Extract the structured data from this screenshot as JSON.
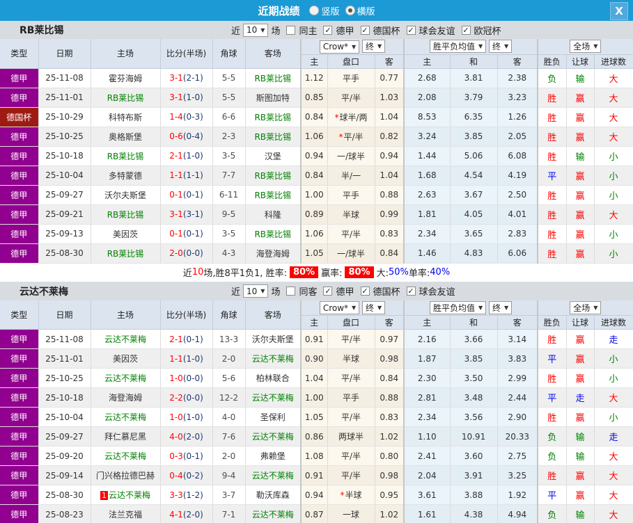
{
  "topbar": {
    "title": "近期战绩",
    "vertical_label": "竖版",
    "horizontal_label": "横版",
    "selected_layout": "横版",
    "close_glyph": "X"
  },
  "colors": {
    "topbar_blue": "#1b9ad6",
    "league_purple": "#91008f",
    "cup_dark_red": "#9e1b14",
    "focus_team_green": "#008000",
    "win_red": "#ff0000",
    "draw_blue": "#0000ee",
    "lose_green": "#008000",
    "score_red": "#ff0000"
  },
  "columns": {
    "type": "类型",
    "date": "日期",
    "home": "主场",
    "score": "比分(半场)",
    "corner": "角球",
    "away": "客场",
    "h": "主",
    "handicap": "盘口",
    "a": "客",
    "avg_h": "主",
    "avg_d": "和",
    "avg_a": "客",
    "result": "胜负",
    "let_ball": "让球",
    "goals": "进球数",
    "company_dd": "Crow*",
    "final_dd": "终",
    "avg_dd": "胜平负均值",
    "full_dd": "全场"
  },
  "sections": [
    {
      "team": "RB莱比锡",
      "filter": {
        "near": "近",
        "count": "10",
        "games": "场",
        "checks": [
          [
            "同主",
            false
          ],
          [
            "德甲",
            true
          ],
          [
            "德国杯",
            true
          ],
          [
            "球会友谊",
            true
          ],
          [
            "欧冠杯",
            true
          ]
        ]
      },
      "rows": [
        {
          "league": "德甲",
          "cup": false,
          "date": "25-11-08",
          "home": "霍芬海姆",
          "homeFocus": false,
          "badge": "",
          "score": "3-1",
          "half": "(2-1)",
          "corner": "5-5",
          "away": "RB莱比锡",
          "awayFocus": true,
          "w1": "1.12",
          "hc": "平手",
          "star": false,
          "w2": "0.77",
          "m1": "2.68",
          "m2": "3.81",
          "m3": "2.38",
          "r1": [
            "负",
            "green"
          ],
          "r2": [
            "输",
            "green"
          ],
          "r3": [
            "大",
            "red"
          ]
        },
        {
          "league": "德甲",
          "cup": false,
          "date": "25-11-01",
          "home": "RB莱比锡",
          "homeFocus": true,
          "badge": "",
          "score": "3-1",
          "half": "(1-0)",
          "corner": "5-5",
          "away": "斯图加特",
          "awayFocus": false,
          "w1": "0.85",
          "hc": "平/半",
          "star": false,
          "w2": "1.03",
          "m1": "2.08",
          "m2": "3.79",
          "m3": "3.23",
          "r1": [
            "胜",
            "red"
          ],
          "r2": [
            "赢",
            "red"
          ],
          "r3": [
            "大",
            "red"
          ]
        },
        {
          "league": "德国杯",
          "cup": true,
          "date": "25-10-29",
          "home": "科特布斯",
          "homeFocus": false,
          "badge": "",
          "score": "1-4",
          "half": "(0-3)",
          "corner": "6-6",
          "away": "RB莱比锡",
          "awayFocus": true,
          "w1": "0.84",
          "hc": "球半/两",
          "star": true,
          "w2": "1.04",
          "m1": "8.53",
          "m2": "6.35",
          "m3": "1.26",
          "r1": [
            "胜",
            "red"
          ],
          "r2": [
            "赢",
            "red"
          ],
          "r3": [
            "大",
            "red"
          ]
        },
        {
          "league": "德甲",
          "cup": false,
          "date": "25-10-25",
          "home": "奥格斯堡",
          "homeFocus": false,
          "badge": "",
          "score": "0-6",
          "half": "(0-4)",
          "corner": "2-3",
          "away": "RB莱比锡",
          "awayFocus": true,
          "w1": "1.06",
          "hc": "平/半",
          "star": true,
          "w2": "0.82",
          "m1": "3.24",
          "m2": "3.85",
          "m3": "2.05",
          "r1": [
            "胜",
            "red"
          ],
          "r2": [
            "赢",
            "red"
          ],
          "r3": [
            "大",
            "red"
          ]
        },
        {
          "league": "德甲",
          "cup": false,
          "date": "25-10-18",
          "home": "RB莱比锡",
          "homeFocus": true,
          "badge": "",
          "score": "2-1",
          "half": "(1-0)",
          "corner": "3-5",
          "away": "汉堡",
          "awayFocus": false,
          "w1": "0.94",
          "hc": "一/球半",
          "star": false,
          "w2": "0.94",
          "m1": "1.44",
          "m2": "5.06",
          "m3": "6.08",
          "r1": [
            "胜",
            "red"
          ],
          "r2": [
            "输",
            "green"
          ],
          "r3": [
            "小",
            "green"
          ]
        },
        {
          "league": "德甲",
          "cup": false,
          "date": "25-10-04",
          "home": "多特蒙德",
          "homeFocus": false,
          "badge": "",
          "score": "1-1",
          "half": "(1-1)",
          "corner": "7-7",
          "away": "RB莱比锡",
          "awayFocus": true,
          "w1": "0.84",
          "hc": "半/一",
          "star": false,
          "w2": "1.04",
          "m1": "1.68",
          "m2": "4.54",
          "m3": "4.19",
          "r1": [
            "平",
            "blue"
          ],
          "r2": [
            "赢",
            "red"
          ],
          "r3": [
            "小",
            "green"
          ]
        },
        {
          "league": "德甲",
          "cup": false,
          "date": "25-09-27",
          "home": "沃尔夫斯堡",
          "homeFocus": false,
          "badge": "",
          "score": "0-1",
          "half": "(0-1)",
          "corner": "6-11",
          "away": "RB莱比锡",
          "awayFocus": true,
          "w1": "1.00",
          "hc": "平手",
          "star": false,
          "w2": "0.88",
          "m1": "2.63",
          "m2": "3.67",
          "m3": "2.50",
          "r1": [
            "胜",
            "red"
          ],
          "r2": [
            "赢",
            "red"
          ],
          "r3": [
            "小",
            "green"
          ]
        },
        {
          "league": "德甲",
          "cup": false,
          "date": "25-09-21",
          "home": "RB莱比锡",
          "homeFocus": true,
          "badge": "",
          "score": "3-1",
          "half": "(3-1)",
          "corner": "9-5",
          "away": "科隆",
          "awayFocus": false,
          "w1": "0.89",
          "hc": "半球",
          "star": false,
          "w2": "0.99",
          "m1": "1.81",
          "m2": "4.05",
          "m3": "4.01",
          "r1": [
            "胜",
            "red"
          ],
          "r2": [
            "赢",
            "red"
          ],
          "r3": [
            "大",
            "red"
          ]
        },
        {
          "league": "德甲",
          "cup": false,
          "date": "25-09-13",
          "home": "美因茨",
          "homeFocus": false,
          "badge": "",
          "score": "0-1",
          "half": "(0-1)",
          "corner": "3-5",
          "away": "RB莱比锡",
          "awayFocus": true,
          "w1": "1.06",
          "hc": "平/半",
          "star": false,
          "w2": "0.83",
          "m1": "2.34",
          "m2": "3.65",
          "m3": "2.83",
          "r1": [
            "胜",
            "red"
          ],
          "r2": [
            "赢",
            "red"
          ],
          "r3": [
            "小",
            "green"
          ]
        },
        {
          "league": "德甲",
          "cup": false,
          "date": "25-08-30",
          "home": "RB莱比锡",
          "homeFocus": true,
          "badge": "",
          "score": "2-0",
          "half": "(0-0)",
          "corner": "4-3",
          "away": "海登海姆",
          "awayFocus": false,
          "w1": "1.05",
          "hc": "一/球半",
          "star": false,
          "w2": "0.84",
          "m1": "1.46",
          "m2": "4.83",
          "m3": "6.06",
          "r1": [
            "胜",
            "red"
          ],
          "r2": [
            "赢",
            "red"
          ],
          "r3": [
            "小",
            "green"
          ]
        }
      ],
      "summary": [
        [
          "近",
          "p"
        ],
        [
          "10",
          "r"
        ],
        [
          "场,胜8平1负1, 胜率:",
          "p"
        ],
        [
          "80%",
          "b"
        ],
        [
          " 赢率:",
          "p"
        ],
        [
          "80%",
          "b"
        ],
        [
          " 大:",
          "p"
        ],
        [
          "50%",
          "u"
        ],
        [
          " 单率:",
          "p"
        ],
        [
          "40%",
          "u"
        ]
      ]
    },
    {
      "team": "云达不莱梅",
      "filter": {
        "near": "近",
        "count": "10",
        "games": "场",
        "checks": [
          [
            "同客",
            false
          ],
          [
            "德甲",
            true
          ],
          [
            "德国杯",
            true
          ],
          [
            "球会友谊",
            true
          ]
        ]
      },
      "rows": [
        {
          "league": "德甲",
          "cup": false,
          "date": "25-11-08",
          "home": "云达不莱梅",
          "homeFocus": true,
          "badge": "",
          "score": "2-1",
          "half": "(0-1)",
          "corner": "13-3",
          "away": "沃尔夫斯堡",
          "awayFocus": false,
          "w1": "0.91",
          "hc": "平/半",
          "star": false,
          "w2": "0.97",
          "m1": "2.16",
          "m2": "3.66",
          "m3": "3.14",
          "r1": [
            "胜",
            "red"
          ],
          "r2": [
            "赢",
            "red"
          ],
          "r3": [
            "走",
            "blue"
          ]
        },
        {
          "league": "德甲",
          "cup": false,
          "date": "25-11-01",
          "home": "美因茨",
          "homeFocus": false,
          "badge": "",
          "score": "1-1",
          "half": "(1-0)",
          "corner": "2-0",
          "away": "云达不莱梅",
          "awayFocus": true,
          "w1": "0.90",
          "hc": "半球",
          "star": false,
          "w2": "0.98",
          "m1": "1.87",
          "m2": "3.85",
          "m3": "3.83",
          "r1": [
            "平",
            "blue"
          ],
          "r2": [
            "赢",
            "red"
          ],
          "r3": [
            "小",
            "green"
          ]
        },
        {
          "league": "德甲",
          "cup": false,
          "date": "25-10-25",
          "home": "云达不莱梅",
          "homeFocus": true,
          "badge": "",
          "score": "1-0",
          "half": "(0-0)",
          "corner": "5-6",
          "away": "柏林联合",
          "awayFocus": false,
          "w1": "1.04",
          "hc": "平/半",
          "star": false,
          "w2": "0.84",
          "m1": "2.30",
          "m2": "3.50",
          "m3": "2.99",
          "r1": [
            "胜",
            "red"
          ],
          "r2": [
            "赢",
            "red"
          ],
          "r3": [
            "小",
            "green"
          ]
        },
        {
          "league": "德甲",
          "cup": false,
          "date": "25-10-18",
          "home": "海登海姆",
          "homeFocus": false,
          "badge": "",
          "score": "2-2",
          "half": "(0-0)",
          "corner": "12-2",
          "away": "云达不莱梅",
          "awayFocus": true,
          "w1": "1.00",
          "hc": "平手",
          "star": false,
          "w2": "0.88",
          "m1": "2.81",
          "m2": "3.48",
          "m3": "2.44",
          "r1": [
            "平",
            "blue"
          ],
          "r2": [
            "走",
            "blue"
          ],
          "r3": [
            "大",
            "red"
          ]
        },
        {
          "league": "德甲",
          "cup": false,
          "date": "25-10-04",
          "home": "云达不莱梅",
          "homeFocus": true,
          "badge": "",
          "score": "1-0",
          "half": "(1-0)",
          "corner": "4-0",
          "away": "圣保利",
          "awayFocus": false,
          "w1": "1.05",
          "hc": "平/半",
          "star": false,
          "w2": "0.83",
          "m1": "2.34",
          "m2": "3.56",
          "m3": "2.90",
          "r1": [
            "胜",
            "red"
          ],
          "r2": [
            "赢",
            "red"
          ],
          "r3": [
            "小",
            "green"
          ]
        },
        {
          "league": "德甲",
          "cup": false,
          "date": "25-09-27",
          "home": "拜仁慕尼黑",
          "homeFocus": false,
          "badge": "",
          "score": "4-0",
          "half": "(2-0)",
          "corner": "7-6",
          "away": "云达不莱梅",
          "awayFocus": true,
          "w1": "0.86",
          "hc": "两球半",
          "star": false,
          "w2": "1.02",
          "m1": "1.10",
          "m2": "10.91",
          "m3": "20.33",
          "r1": [
            "负",
            "green"
          ],
          "r2": [
            "输",
            "green"
          ],
          "r3": [
            "走",
            "blue"
          ]
        },
        {
          "league": "德甲",
          "cup": false,
          "date": "25-09-20",
          "home": "云达不莱梅",
          "homeFocus": true,
          "badge": "",
          "score": "0-3",
          "half": "(0-1)",
          "corner": "2-0",
          "away": "弗赖堡",
          "awayFocus": false,
          "w1": "1.08",
          "hc": "平/半",
          "star": false,
          "w2": "0.80",
          "m1": "2.41",
          "m2": "3.60",
          "m3": "2.75",
          "r1": [
            "负",
            "green"
          ],
          "r2": [
            "输",
            "green"
          ],
          "r3": [
            "大",
            "red"
          ]
        },
        {
          "league": "德甲",
          "cup": false,
          "date": "25-09-14",
          "home": "门兴格拉德巴赫",
          "homeFocus": false,
          "badge": "",
          "score": "0-4",
          "half": "(0-2)",
          "corner": "9-4",
          "away": "云达不莱梅",
          "awayFocus": true,
          "w1": "0.91",
          "hc": "平/半",
          "star": false,
          "w2": "0.98",
          "m1": "2.04",
          "m2": "3.91",
          "m3": "3.25",
          "r1": [
            "胜",
            "red"
          ],
          "r2": [
            "赢",
            "red"
          ],
          "r3": [
            "大",
            "red"
          ]
        },
        {
          "league": "德甲",
          "cup": false,
          "date": "25-08-30",
          "home": "云达不莱梅",
          "homeFocus": true,
          "badge": "1",
          "score": "3-3",
          "half": "(1-2)",
          "corner": "3-7",
          "away": "勒沃库森",
          "awayFocus": false,
          "w1": "0.94",
          "hc": "半球",
          "star": true,
          "w2": "0.95",
          "m1": "3.61",
          "m2": "3.88",
          "m3": "1.92",
          "r1": [
            "平",
            "blue"
          ],
          "r2": [
            "赢",
            "red"
          ],
          "r3": [
            "大",
            "red"
          ]
        },
        {
          "league": "德甲",
          "cup": false,
          "date": "25-08-23",
          "home": "法兰克福",
          "homeFocus": false,
          "badge": "",
          "score": "4-1",
          "half": "(2-0)",
          "corner": "7-1",
          "away": "云达不莱梅",
          "awayFocus": true,
          "w1": "0.87",
          "hc": "一球",
          "star": false,
          "w2": "1.02",
          "m1": "1.61",
          "m2": "4.38",
          "m3": "4.94",
          "r1": [
            "负",
            "green"
          ],
          "r2": [
            "输",
            "green"
          ],
          "r3": [
            "大",
            "red"
          ]
        }
      ],
      "summary": []
    }
  ]
}
